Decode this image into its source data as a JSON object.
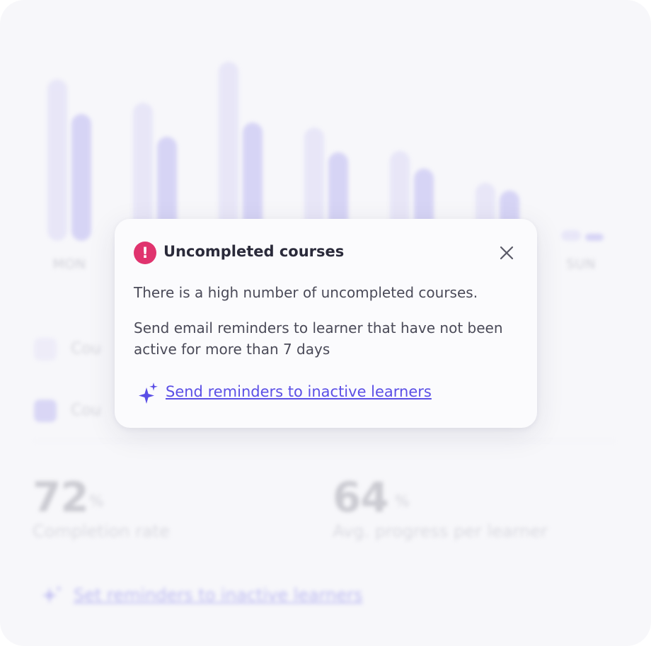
{
  "background": {
    "days": [
      "MON",
      "SUN"
    ],
    "legend": [
      "Cou",
      "Cou"
    ],
    "stats": [
      {
        "value": "72",
        "unit": "%",
        "label": "Completion rate"
      },
      {
        "value": "64",
        "unit": "%",
        "label": "Avg. progress per learner"
      }
    ],
    "link_label": "Set reminders to inactive learners"
  },
  "chart_data": {
    "type": "bar",
    "categories": [
      "MON",
      "",
      "",
      "",
      "",
      "",
      "SUN"
    ],
    "series": [
      {
        "values": [
          228,
          195,
          253,
          160,
          127,
          82,
          15
        ]
      },
      {
        "values": [
          179,
          147,
          167,
          125,
          102,
          71,
          10
        ]
      }
    ],
    "ylim": [
      0,
      260
    ]
  },
  "popup": {
    "title": "Uncompleted courses",
    "alert_icon": "alert-icon",
    "message_line1": "There is a high number of uncompleted courses.",
    "message_line2": "Send email reminders to learner that have not been active for more than 7 days",
    "action_label": "Send reminders to inactive learners",
    "colors": {
      "alert": "#e0336e",
      "link": "#5b4fe6"
    }
  }
}
